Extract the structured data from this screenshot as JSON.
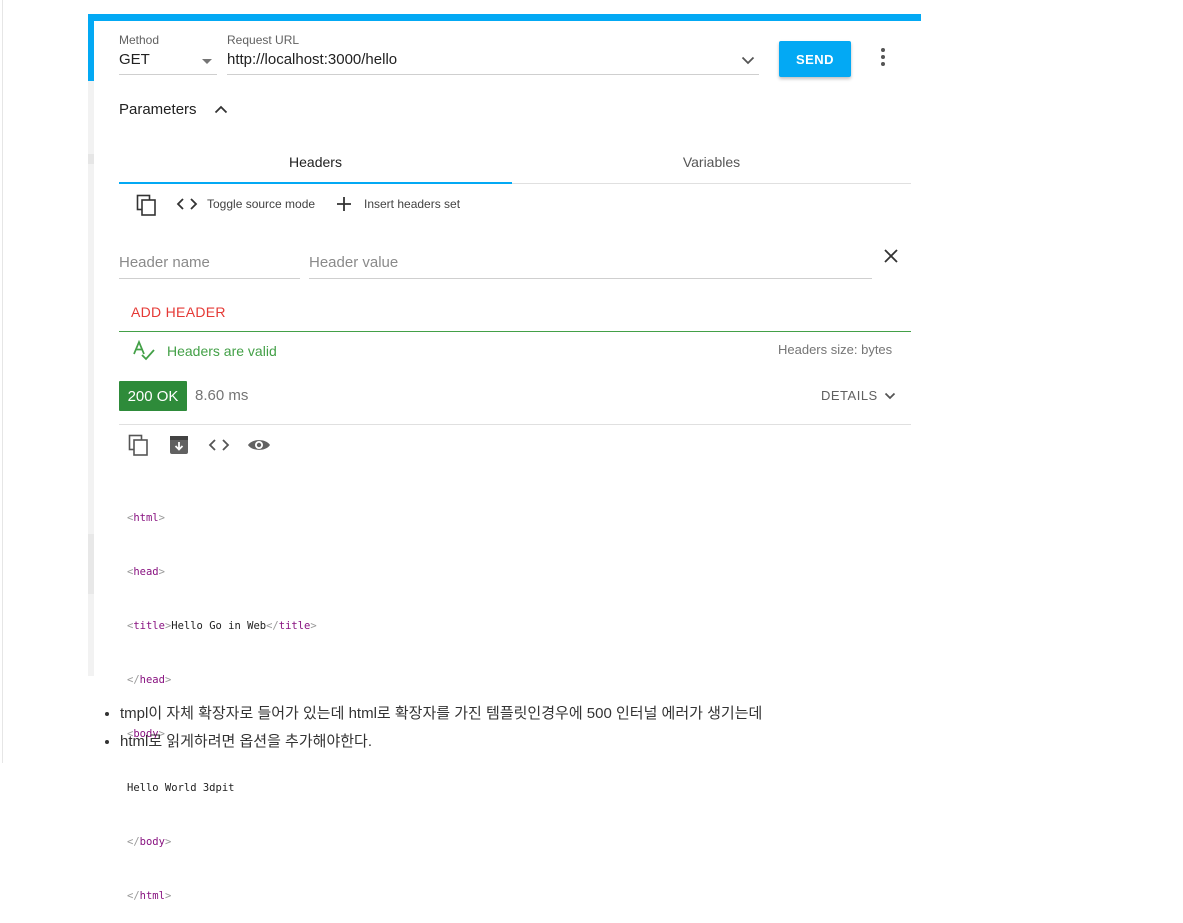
{
  "request": {
    "method_label": "Method",
    "method_value": "GET",
    "url_label": "Request URL",
    "url_value": "http://localhost:3000/hello",
    "send_label": "SEND"
  },
  "parameters": {
    "title": "Parameters"
  },
  "tabs": [
    {
      "label": "Headers",
      "active": true
    },
    {
      "label": "Variables",
      "active": false
    }
  ],
  "toolbar": {
    "toggle_source": "Toggle source mode",
    "insert_headers": "Insert headers set"
  },
  "header_row": {
    "name_placeholder": "Header name",
    "value_placeholder": "Header value"
  },
  "add_header_label": "ADD HEADER",
  "validation": {
    "message": "Headers are valid",
    "size_text": "Headers size: bytes"
  },
  "response": {
    "status": "200 OK",
    "time": "8.60 ms",
    "details_label": "DETAILS",
    "body_lines": [
      {
        "open": "<",
        "tag": "html",
        "close": ">",
        "text": "",
        "tag2": "",
        "close_tag": ""
      },
      {
        "open": "<",
        "tag": "head",
        "close": ">",
        "text": "",
        "tag2": "",
        "close_tag": ""
      },
      {
        "open": "<",
        "tag": "title",
        "close": ">",
        "text": "Hello Go in Web",
        "tag2": "title",
        "close_tag": "</"
      },
      {
        "open": "</",
        "tag": "head",
        "close": ">",
        "text": "",
        "tag2": "",
        "close_tag": ""
      },
      {
        "open": "<",
        "tag": "body",
        "close": ">",
        "text": "",
        "tag2": "",
        "close_tag": ""
      },
      {
        "open": "",
        "tag": "",
        "close": "",
        "text": "Hello World 3dpit",
        "tag2": "",
        "close_tag": ""
      },
      {
        "open": "</",
        "tag": "body",
        "close": ">",
        "text": "",
        "tag2": "",
        "close_tag": ""
      },
      {
        "open": "</",
        "tag": "html",
        "close": ">",
        "text": "",
        "tag2": "",
        "close_tag": ""
      }
    ]
  },
  "notes": [
    "tmpl이 자체 확장자로 들어가 있는데 html로 확장자를 가진 템플릿인경우에 500 인터널 에러가 생기는데",
    "html로 읽게하려면 옵션을 추가해야한다."
  ],
  "colors": {
    "accent": "#03a9f4",
    "success": "#2e8b3a",
    "valid_text": "#43a047",
    "add_header": "#e53935",
    "tag": "#881280"
  }
}
